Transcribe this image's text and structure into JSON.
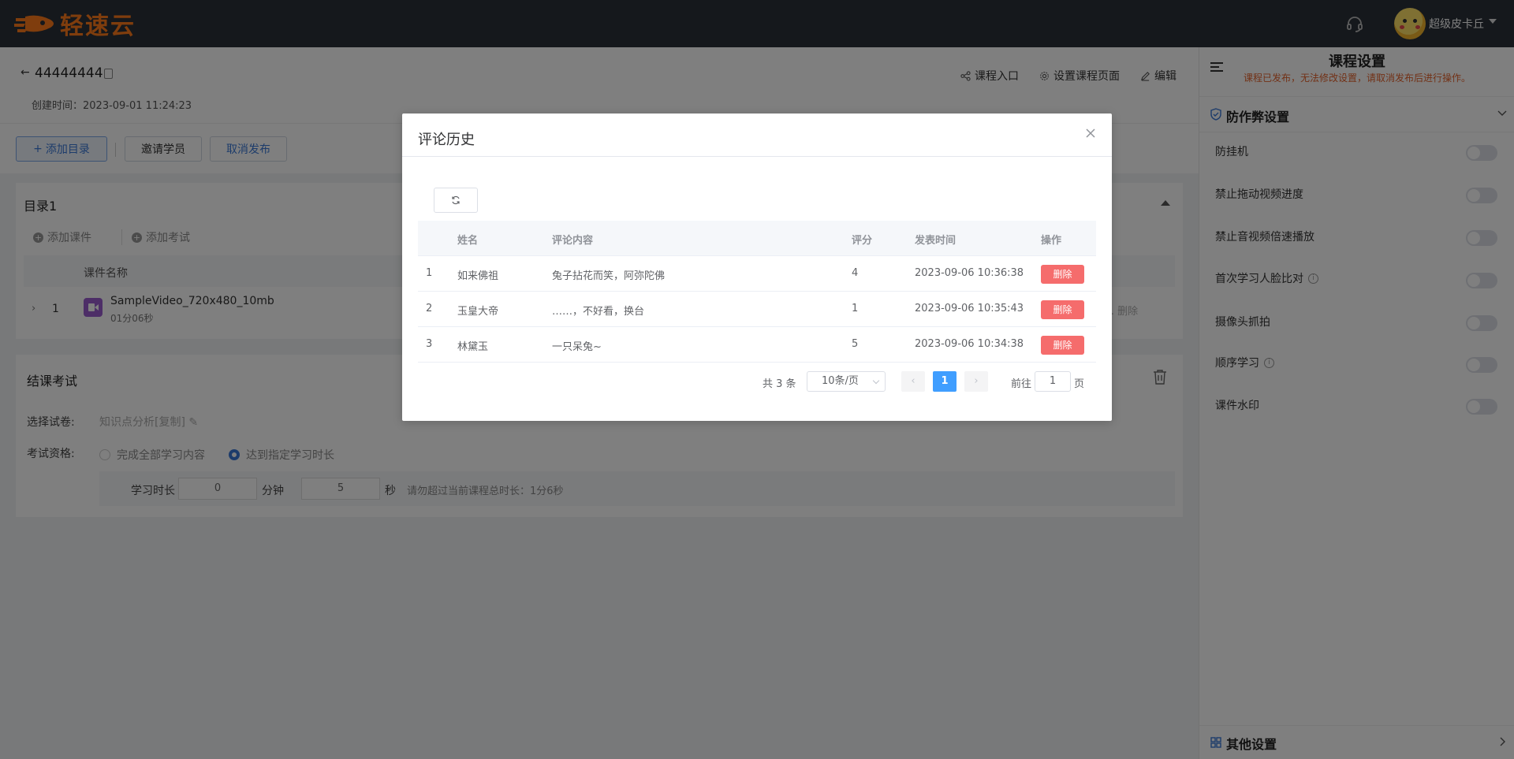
{
  "brand": {
    "name": "轻速云",
    "accent": "#ff7a1a"
  },
  "topbar": {
    "username": "超级皮卡丘",
    "support_icon": "headset-icon"
  },
  "course": {
    "title": "44444444",
    "created": "创建时间：2023-09-01 11:24:23",
    "actions": {
      "entry": "课程入口",
      "page_settings": "设置课程页面",
      "edit": "编辑"
    },
    "buttons": {
      "add_catalog": "添加目录",
      "invite": "邀请学员",
      "unpublish": "取消发布"
    }
  },
  "catalog": {
    "title": "目录1",
    "add_courseware": "添加课件",
    "add_exam": "添加考试",
    "column_name": "课件名称",
    "rows": [
      {
        "no": "1",
        "name": "SampleVideo_720x480_10mb",
        "duration": "01分06秒",
        "ops": "… 删除"
      }
    ]
  },
  "exam": {
    "title": "结课考试",
    "paper_label": "选择试卷:",
    "paper_value": "知识点分析[复制]",
    "qual_label": "考试资格:",
    "opt_all": "完成全部学习内容",
    "opt_time": "达到指定学习时长",
    "time_label": "学习时长",
    "minutes_value": "0",
    "minutes_unit": "分钟",
    "seconds_value": "5",
    "seconds_unit": "秒",
    "tip": "请勿超过当前课程总时长：1分6秒"
  },
  "settings_panel": {
    "title": "课程设置",
    "subtitle": "课程已发布，无法修改设置，请取消发布后进行操作。",
    "section": "防作弊设置",
    "items": [
      {
        "label": "防挂机",
        "info": false,
        "enabled": false
      },
      {
        "label": "禁止拖动视频进度",
        "info": false,
        "enabled": false
      },
      {
        "label": "禁止音视频倍速播放",
        "info": false,
        "enabled": false
      },
      {
        "label": "首次学习人脸比对",
        "info": true,
        "enabled": false
      },
      {
        "label": "摄像头抓拍",
        "info": false,
        "enabled": false
      },
      {
        "label": "顺序学习",
        "info": true,
        "enabled": false
      },
      {
        "label": "课件水印",
        "info": false,
        "enabled": false
      }
    ],
    "other_section": "其他设置"
  },
  "modal": {
    "title": "评论历史",
    "columns": {
      "name": "姓名",
      "content": "评论内容",
      "score": "评分",
      "time": "发表时间",
      "op": "操作"
    },
    "delete_label": "删除",
    "rows": [
      {
        "idx": "1",
        "name": "如来佛祖",
        "content": "兔子拈花而笑，阿弥陀佛",
        "score": "4",
        "time": "2023-09-06 10:36:38"
      },
      {
        "idx": "2",
        "name": "玉皇大帝",
        "content": "……，不好看，换台",
        "score": "1",
        "time": "2023-09-06 10:35:43"
      },
      {
        "idx": "3",
        "name": "林黛玉",
        "content": "一只呆兔~",
        "score": "5",
        "time": "2023-09-06 10:34:38"
      }
    ],
    "pagination": {
      "total": "共 3 条",
      "page_size": "10条/页",
      "prev": "‹",
      "next": "›",
      "current": "1",
      "goto_label": "前往",
      "goto_value": "1",
      "goto_unit": "页"
    }
  }
}
